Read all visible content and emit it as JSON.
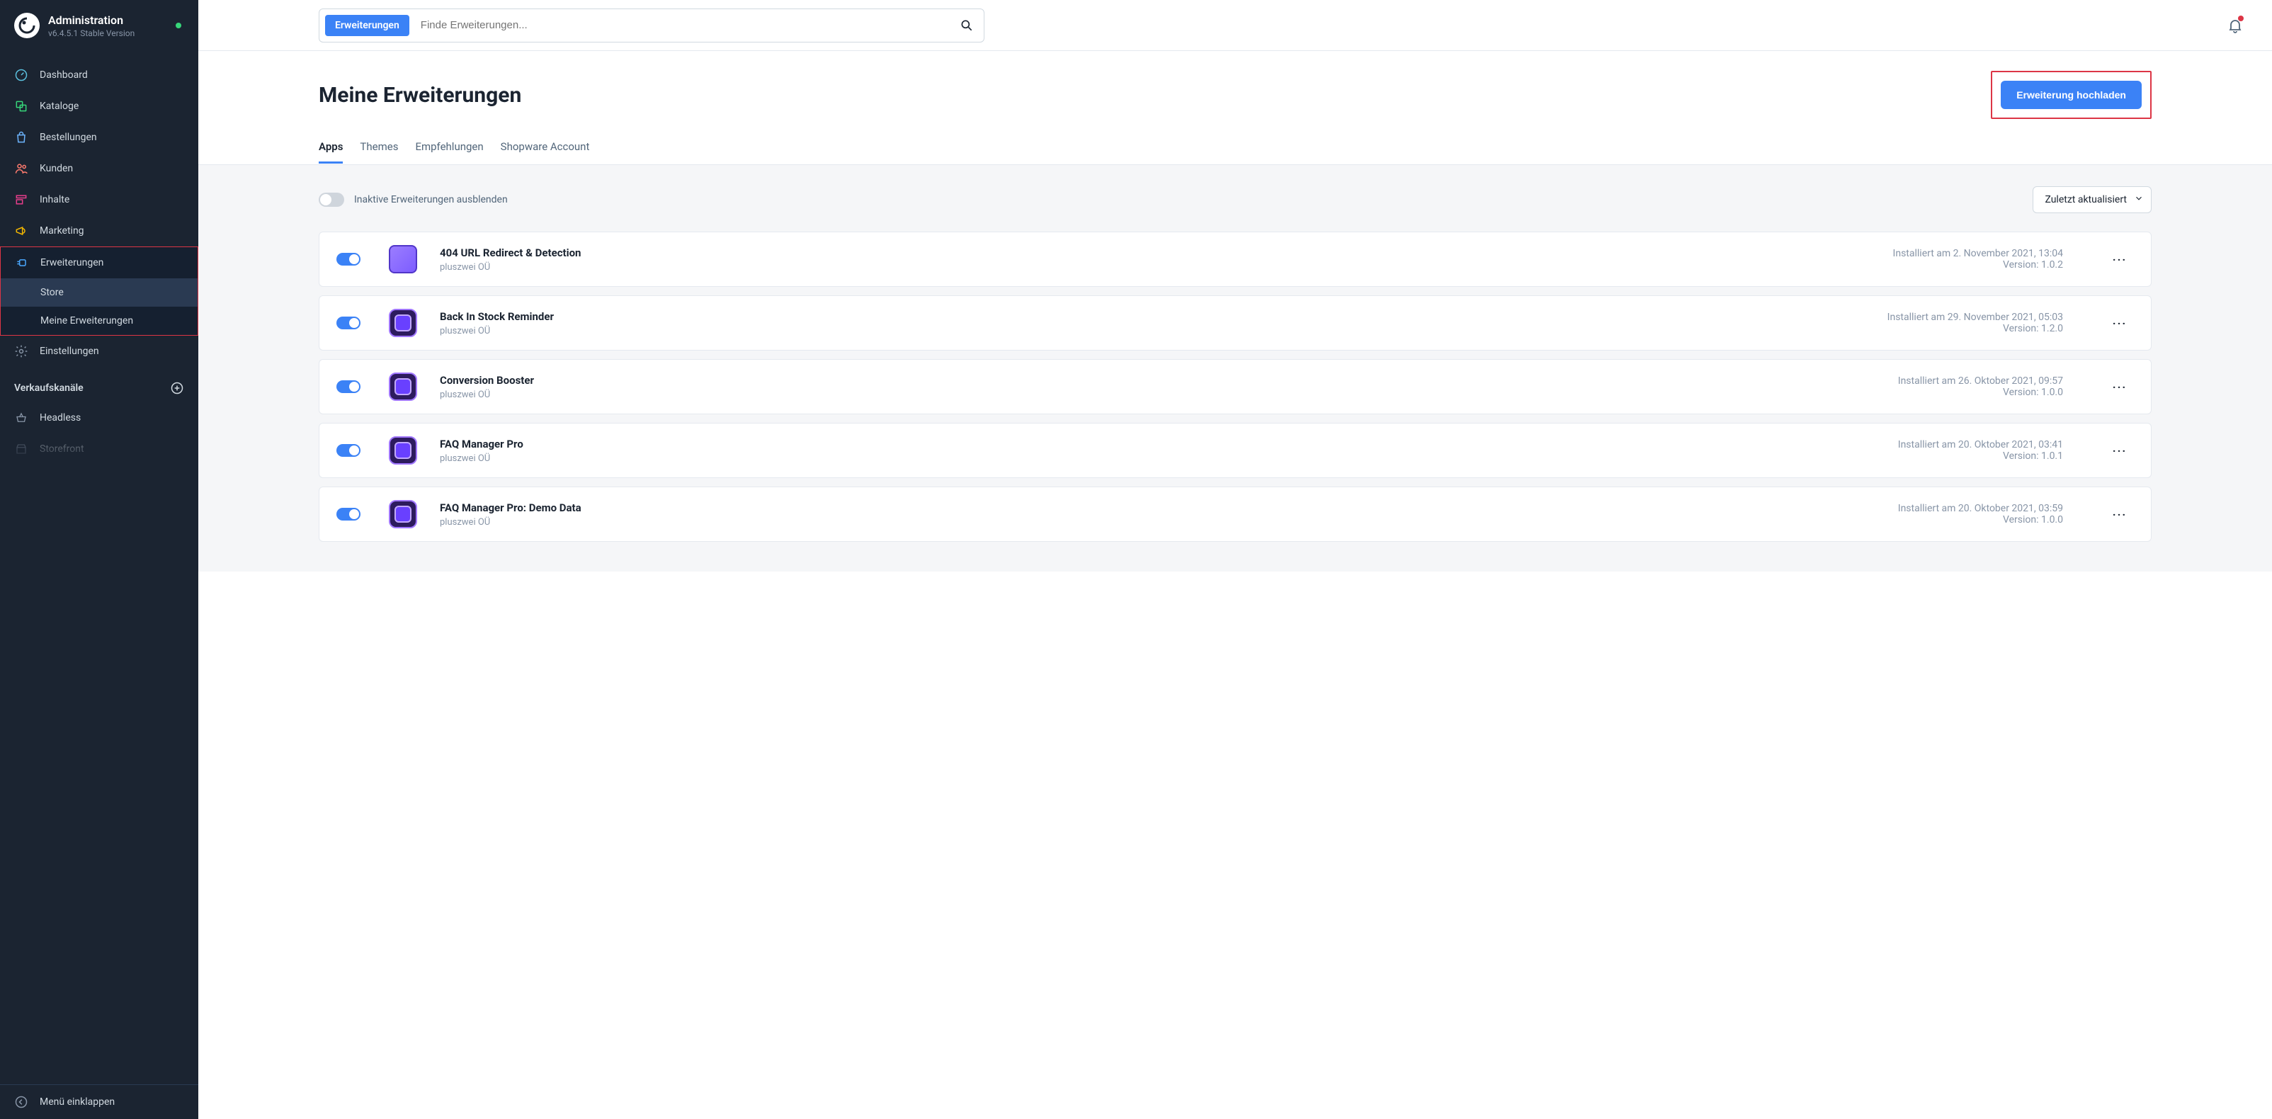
{
  "sidebar": {
    "title": "Administration",
    "version": "v6.4.5.1 Stable Version",
    "items": {
      "dashboard": "Dashboard",
      "catalogs": "Kataloge",
      "orders": "Bestellungen",
      "customers": "Kunden",
      "content": "Inhalte",
      "marketing": "Marketing",
      "extensions": "Erweiterungen",
      "store": "Store",
      "my_extensions": "Meine Erweiterungen",
      "settings": "Einstellungen"
    },
    "channels_heading": "Verkaufskanäle",
    "channels": {
      "headless": "Headless",
      "storefront": "Storefront"
    },
    "collapse": "Menü einklappen"
  },
  "search": {
    "tag": "Erweiterungen",
    "placeholder": "Finde Erweiterungen..."
  },
  "page": {
    "title": "Meine Erweiterungen",
    "upload_button": "Erweiterung hochladen"
  },
  "tabs": {
    "apps": "Apps",
    "themes": "Themes",
    "recommendations": "Empfehlungen",
    "account": "Shopware Account"
  },
  "filters": {
    "hide_inactive": "Inaktive Erweiterungen ausblenden",
    "sort": "Zuletzt aktualisiert"
  },
  "extensions": [
    {
      "name": "404 URL Redirect & Detection",
      "author": "pluszwei OÜ",
      "installed": "Installiert am 2. November 2021, 13:04",
      "version": "Version: 1.0.2",
      "icon": "purple1"
    },
    {
      "name": "Back In Stock Reminder",
      "author": "pluszwei OÜ",
      "installed": "Installiert am 29. November 2021, 05:03",
      "version": "Version: 1.2.0",
      "icon": "purple2"
    },
    {
      "name": "Conversion Booster",
      "author": "pluszwei OÜ",
      "installed": "Installiert am 26. Oktober 2021, 09:57",
      "version": "Version: 1.0.0",
      "icon": "purple2"
    },
    {
      "name": "FAQ Manager Pro",
      "author": "pluszwei OÜ",
      "installed": "Installiert am 20. Oktober 2021, 03:41",
      "version": "Version: 1.0.1",
      "icon": "purple2"
    },
    {
      "name": "FAQ Manager Pro: Demo Data",
      "author": "pluszwei OÜ",
      "installed": "Installiert am 20. Oktober 2021, 03:59",
      "version": "Version: 1.0.0",
      "icon": "purple2"
    }
  ]
}
